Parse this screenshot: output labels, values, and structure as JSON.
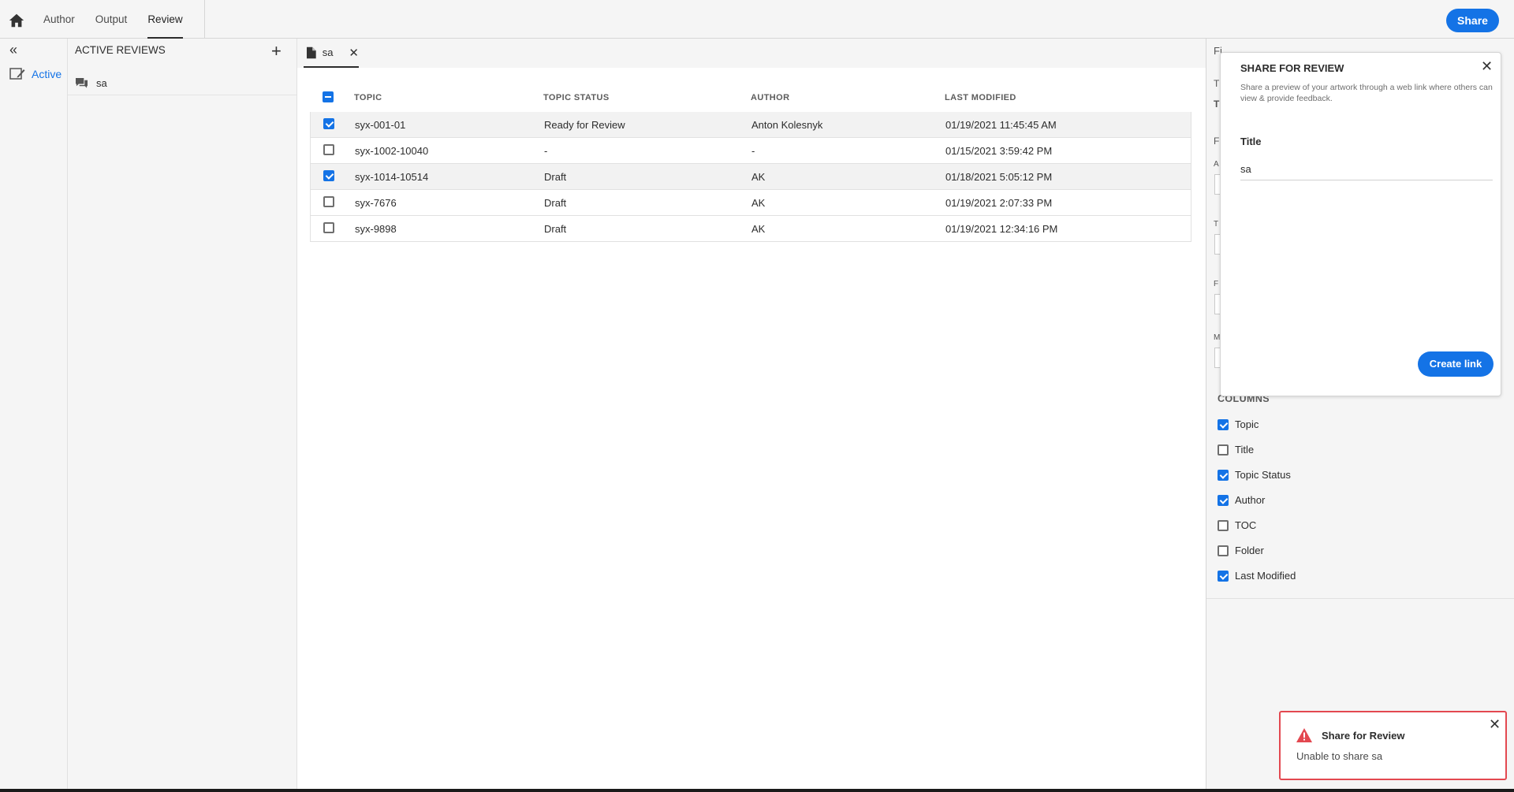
{
  "topbar": {
    "tabs": [
      "Author",
      "Output",
      "Review"
    ],
    "active_tab": "Review",
    "share_label": "Share"
  },
  "rail": {
    "collapse_glyph": "«",
    "active_label": "Active"
  },
  "reviews": {
    "title": "ACTIVE REVIEWS",
    "add_glyph": "+",
    "items": [
      {
        "label": "sa"
      }
    ]
  },
  "doc_tab": {
    "label": "sa",
    "close_glyph": "✕"
  },
  "table": {
    "columns": [
      "TOPIC",
      "TOPIC STATUS",
      "AUTHOR",
      "LAST MODIFIED"
    ],
    "rows": [
      {
        "topic": "syx-001-01",
        "status": "Ready for Review",
        "author": "Anton Kolesnyk",
        "modified": "01/19/2021 11:45:45 AM",
        "checked": true
      },
      {
        "topic": "syx-1002-10040",
        "status": "-",
        "author": "-",
        "modified": "01/15/2021 3:59:42 PM",
        "checked": false
      },
      {
        "topic": "syx-1014-10514",
        "status": "Draft",
        "author": "AK",
        "modified": "01/18/2021 5:05:12 PM",
        "checked": true
      },
      {
        "topic": "syx-7676",
        "status": "Draft",
        "author": "AK",
        "modified": "01/19/2021 2:07:33 PM",
        "checked": false
      },
      {
        "topic": "syx-9898",
        "status": "Draft",
        "author": "AK",
        "modified": "01/19/2021 12:34:16 PM",
        "checked": false
      }
    ]
  },
  "right_panel": {
    "fragments": [
      "Fi",
      "T",
      "T",
      "F",
      "A",
      "T",
      "F",
      "M"
    ],
    "columns_title": "COLUMNS",
    "columns": [
      {
        "label": "Topic",
        "checked": true
      },
      {
        "label": "Title",
        "checked": false
      },
      {
        "label": "Topic Status",
        "checked": true
      },
      {
        "label": "Author",
        "checked": true
      },
      {
        "label": "TOC",
        "checked": false
      },
      {
        "label": "Folder",
        "checked": false
      },
      {
        "label": "Last Modified",
        "checked": true
      }
    ]
  },
  "share_popover": {
    "title": "SHARE FOR REVIEW",
    "description": "Share a preview of your artwork through a web link where others can view & provide feedback.",
    "field_label": "Title",
    "field_value": "sa",
    "create_label": "Create link",
    "close_glyph": "✕"
  },
  "toast": {
    "title": "Share for Review",
    "message": "Unable to share sa",
    "close_glyph": "✕"
  },
  "colors": {
    "accent": "#1473e6",
    "error": "#e34850"
  }
}
